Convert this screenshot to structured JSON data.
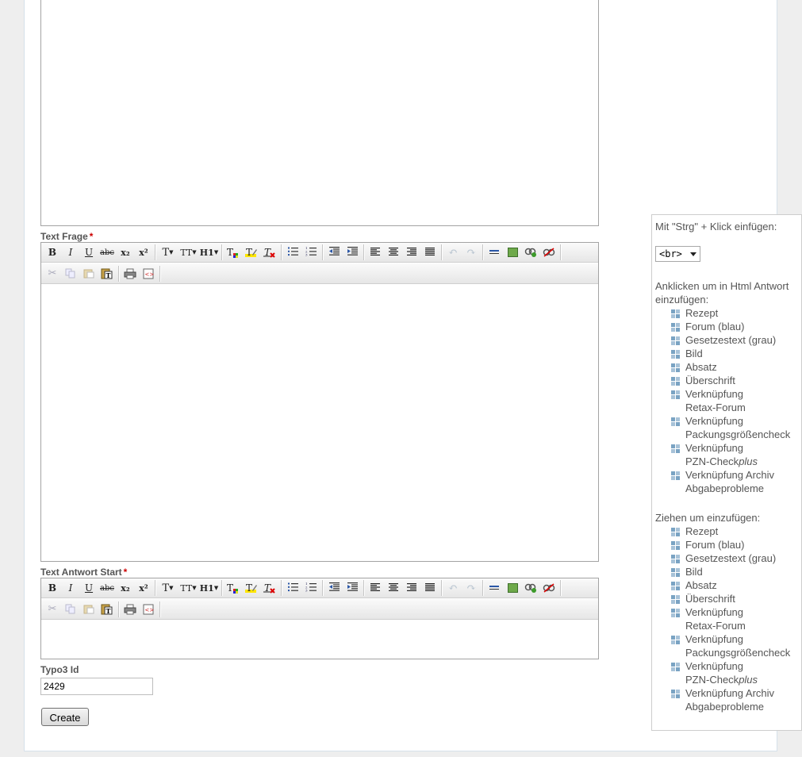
{
  "form": {
    "field_text_frage": "Text Frage",
    "field_text_antwort_start": "Text Antwort Start",
    "field_typo3_id": "Typo3 Id",
    "required_marker": "*",
    "typo3_id_value": "2429",
    "create_label": "Create"
  },
  "toolbar": {
    "bold": "B",
    "italic": "I",
    "underline": "U",
    "strike": "abc",
    "subscript": "x₂",
    "superscript": "x²",
    "font_size": "T",
    "font_family": "TT",
    "heading": "H1"
  },
  "sidebar": {
    "ctrl_click_hint": "Mit \"Strg\" + Klick einfügen:",
    "br_select_value": "<br>",
    "click_hint": "Anklicken um in Html Antwort einzufügen:",
    "drag_hint": "Ziehen um einzufügen:",
    "click_items": [
      {
        "l1": "Rezept",
        "l2": ""
      },
      {
        "l1": "Forum (blau)",
        "l2": ""
      },
      {
        "l1": "Gesetzestext (grau)",
        "l2": ""
      },
      {
        "l1": "Bild",
        "l2": ""
      },
      {
        "l1": "Absatz",
        "l2": ""
      },
      {
        "l1": "Überschrift",
        "l2": ""
      },
      {
        "l1": "Verknüpfung",
        "l2": "Retax-Forum"
      },
      {
        "l1": "Verknüpfung",
        "l2": "Packungsgrößencheck"
      },
      {
        "l1": "Verknüpfung",
        "l2": "PZN-Check",
        "l2_em": "plus"
      },
      {
        "l1": "Verknüpfung Archiv",
        "l2": "Abgabeprobleme"
      }
    ],
    "drag_items": [
      {
        "l1": "Rezept",
        "l2": ""
      },
      {
        "l1": "Forum (blau)",
        "l2": ""
      },
      {
        "l1": "Gesetzestext (grau)",
        "l2": ""
      },
      {
        "l1": "Bild",
        "l2": ""
      },
      {
        "l1": "Absatz",
        "l2": ""
      },
      {
        "l1": "Überschrift",
        "l2": ""
      },
      {
        "l1": "Verknüpfung",
        "l2": "Retax-Forum"
      },
      {
        "l1": "Verknüpfung",
        "l2": "Packungsgrößencheck"
      },
      {
        "l1": "Verknüpfung",
        "l2": "PZN-Check",
        "l2_em": "plus"
      },
      {
        "l1": "Verknüpfung Archiv",
        "l2": "Abgabeprobleme"
      }
    ]
  }
}
